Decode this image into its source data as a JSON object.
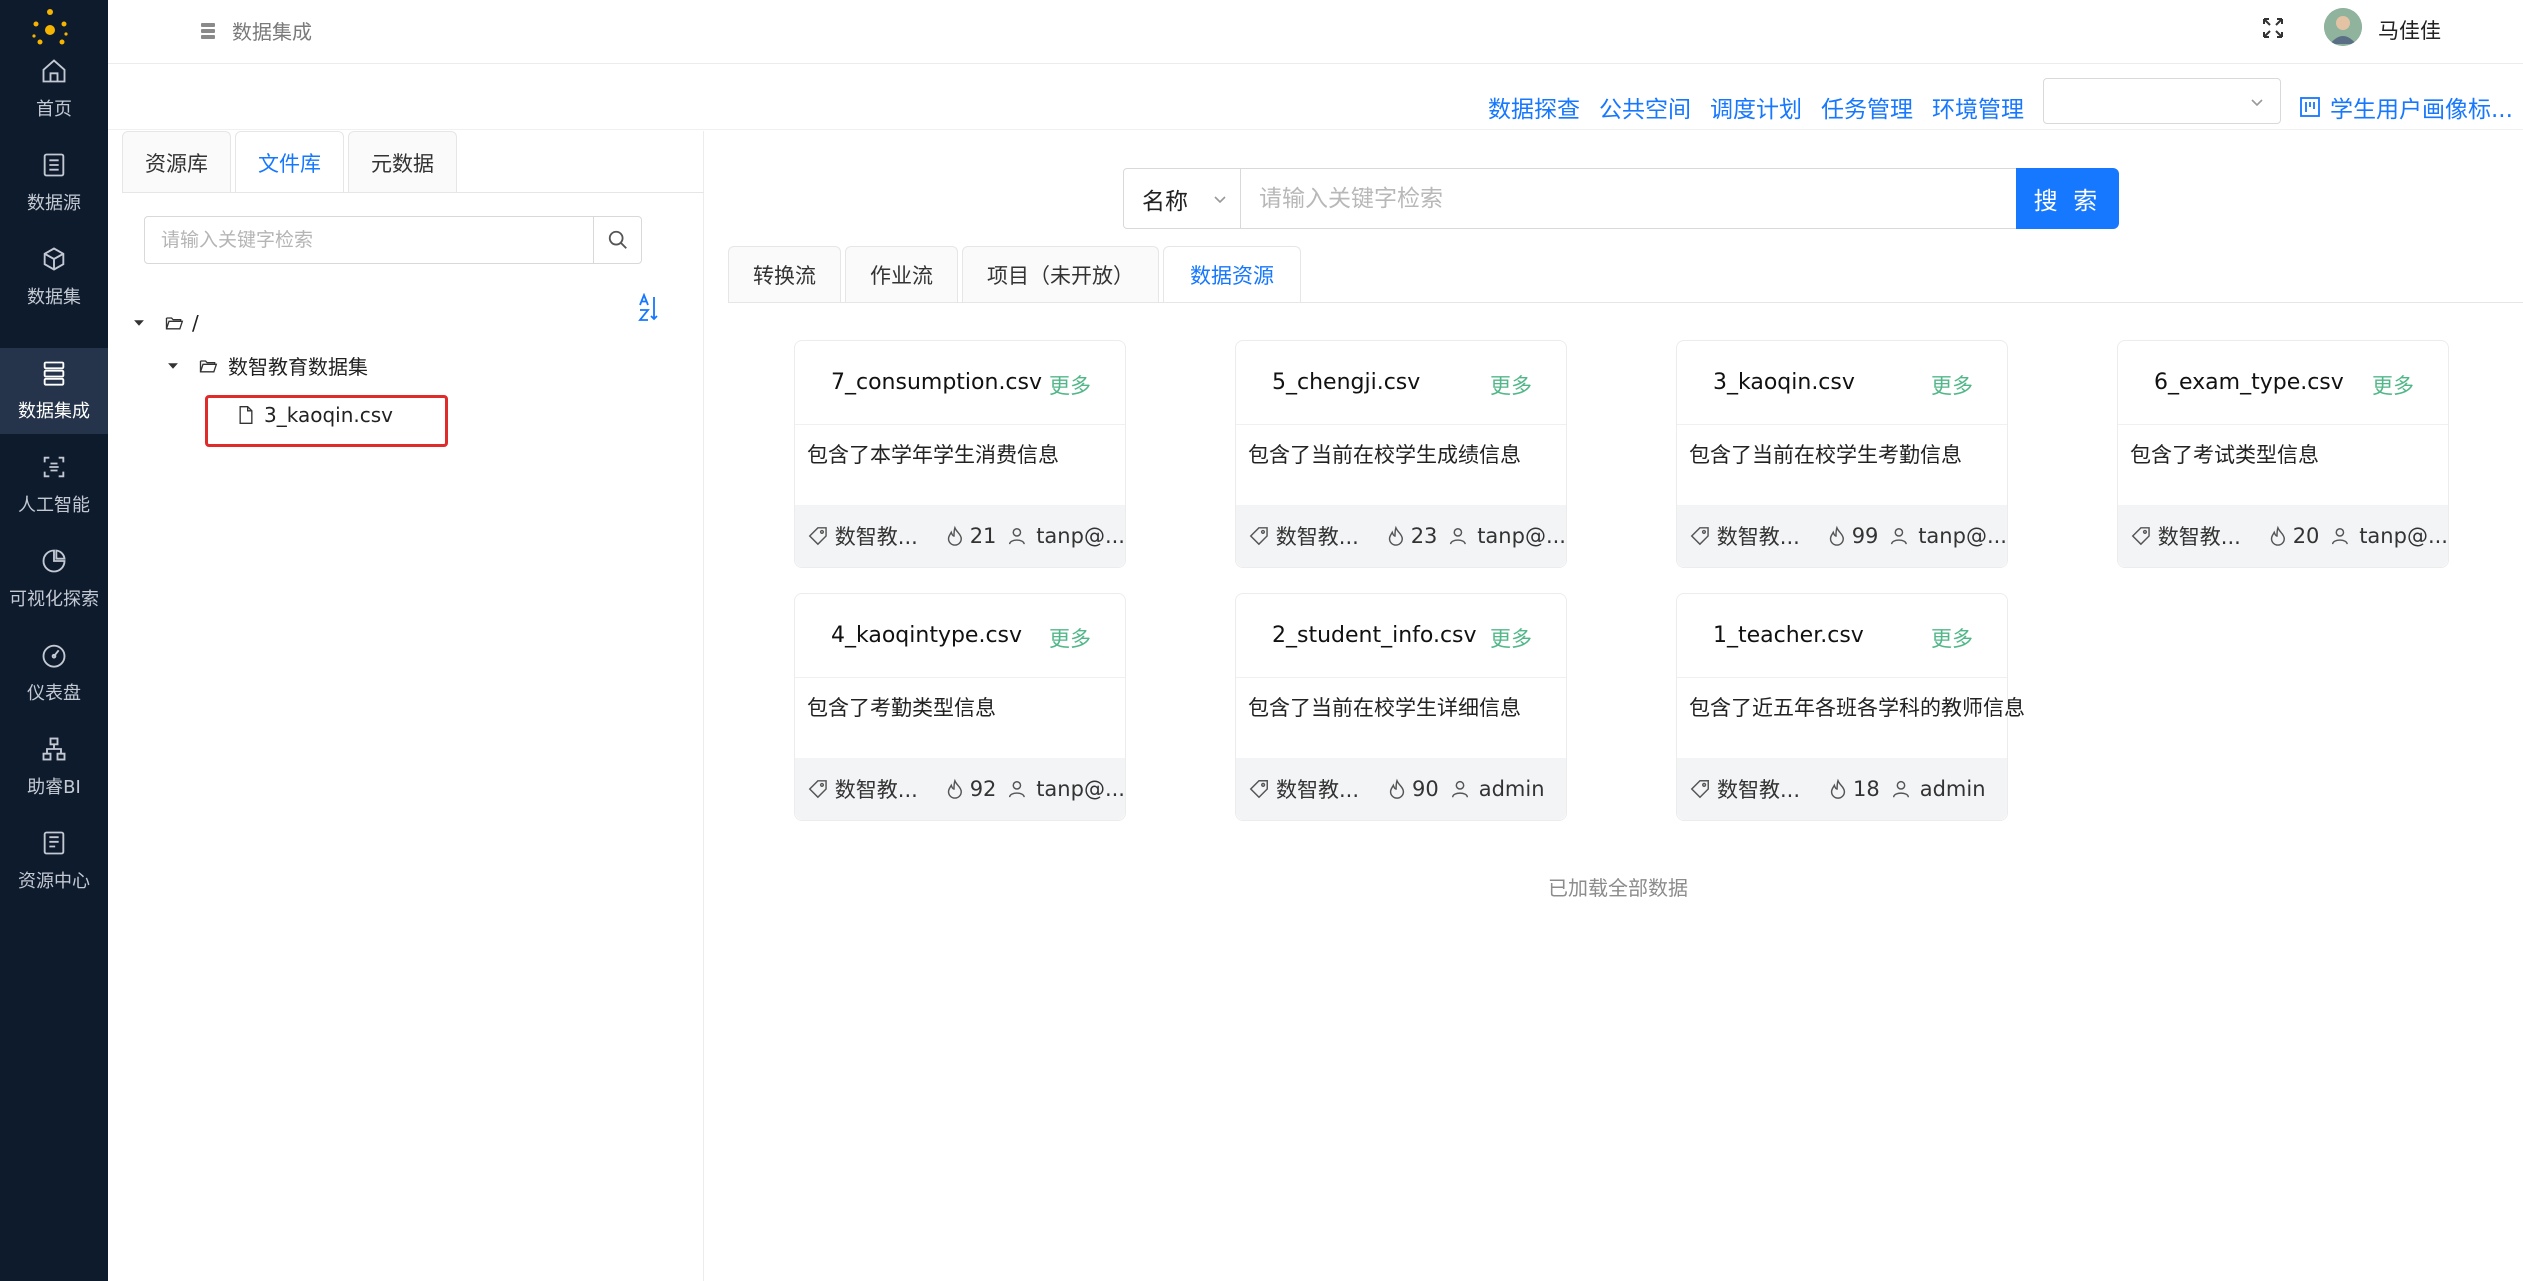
{
  "nav": {
    "items": [
      {
        "label": "首页",
        "icon": "home-icon"
      },
      {
        "label": "数据源",
        "icon": "datasource-icon"
      },
      {
        "label": "数据集",
        "icon": "cube-icon"
      },
      {
        "label": "数据集成",
        "icon": "database-icon",
        "active": true
      },
      {
        "label": "人工智能",
        "icon": "ai-icon"
      },
      {
        "label": "可视化探索",
        "icon": "pie-chart-icon"
      },
      {
        "label": "仪表盘",
        "icon": "dashboard-icon"
      },
      {
        "label": "助睿BI",
        "icon": "org-chart-icon"
      },
      {
        "label": "资源中心",
        "icon": "resource-icon"
      }
    ]
  },
  "header": {
    "breadcrumb": "数据集成",
    "user_name": "马佳佳",
    "links": [
      "数据探查",
      "公共空间",
      "调度计划",
      "任务管理",
      "环境管理"
    ],
    "env_select_value": "",
    "report_link": "学生用户画像标..."
  },
  "left_panel": {
    "tabs": [
      "资源库",
      "文件库",
      "元数据"
    ],
    "active_tab": "文件库",
    "search_placeholder": "请输入关键字检索",
    "tree": {
      "root": "/",
      "folder": "数智教育数据集",
      "file": "3_kaoqin.csv"
    }
  },
  "main": {
    "search": {
      "field": "名称",
      "placeholder": "请输入关键字检索",
      "button": "搜 索"
    },
    "tabs": [
      "转换流",
      "作业流",
      "项目（未开放）",
      "数据资源"
    ],
    "active_tab": "数据资源",
    "more_label": "更多",
    "cards": [
      {
        "title": "7_consumption.csv",
        "desc": "包含了本学年学生消费信息",
        "tag": "数智教...",
        "count": "21",
        "user": "tanp@..."
      },
      {
        "title": "5_chengji.csv",
        "desc": "包含了当前在校学生成绩信息",
        "tag": "数智教...",
        "count": "23",
        "user": "tanp@..."
      },
      {
        "title": "3_kaoqin.csv",
        "desc": "包含了当前在校学生考勤信息",
        "tag": "数智教...",
        "count": "99",
        "user": "tanp@..."
      },
      {
        "title": "6_exam_type.csv",
        "desc": "包含了考试类型信息",
        "tag": "数智教...",
        "count": "20",
        "user": "tanp@..."
      },
      {
        "title": "4_kaoqintype.csv",
        "desc": "包含了考勤类型信息",
        "tag": "数智教...",
        "count": "92",
        "user": "tanp@..."
      },
      {
        "title": "2_student_info.csv",
        "desc": "包含了当前在校学生详细信息",
        "tag": "数智教...",
        "count": "90",
        "user": "admin"
      },
      {
        "title": "1_teacher.csv",
        "desc": "包含了近五年各班各学科的教师信息",
        "tag": "数智教...",
        "count": "18",
        "user": "admin"
      }
    ],
    "loaded_text": "已加载全部数据"
  },
  "colors": {
    "nav_bg": "#0e1b2c",
    "nav_active": "#25344a",
    "primary": "#1677ff",
    "more_green": "#52b788",
    "selection_red": "#e02b2b"
  }
}
